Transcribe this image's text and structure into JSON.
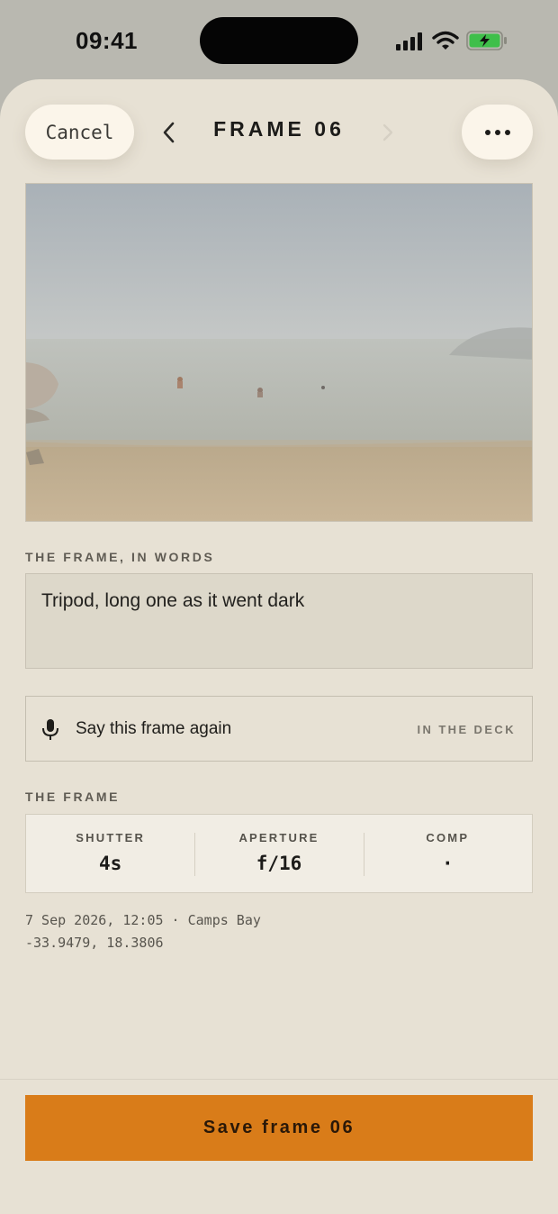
{
  "status_bar": {
    "time": "09:41"
  },
  "header": {
    "cancel_label": "Cancel",
    "title": "FRAME 06",
    "prev_icon": "chevron-left-icon",
    "next_icon": "chevron-right-icon",
    "more_icon": "ellipsis-icon"
  },
  "photo": {
    "subject": "foggy beach with swimmers"
  },
  "description": {
    "section_label": "THE FRAME, IN WORDS",
    "text": "Tripod, long one as it went dark"
  },
  "voice": {
    "icon": "microphone-icon",
    "label": "Say this frame again",
    "tag": "IN THE DECK"
  },
  "frame": {
    "section_label": "THE FRAME",
    "stats": [
      {
        "label": "SHUTTER",
        "value": "4s"
      },
      {
        "label": "APERTURE",
        "value": "f/16"
      },
      {
        "label": "COMP",
        "value": "·"
      }
    ]
  },
  "meta": {
    "line1": "7 Sep 2026, 12:05 · Camps Bay",
    "line2": "-33.9479, 18.3806"
  },
  "footer": {
    "save_label": "Save frame 06"
  },
  "colors": {
    "accent": "#d97c19",
    "sheet": "#e7e1d4",
    "battery": "#3fbf4a"
  }
}
